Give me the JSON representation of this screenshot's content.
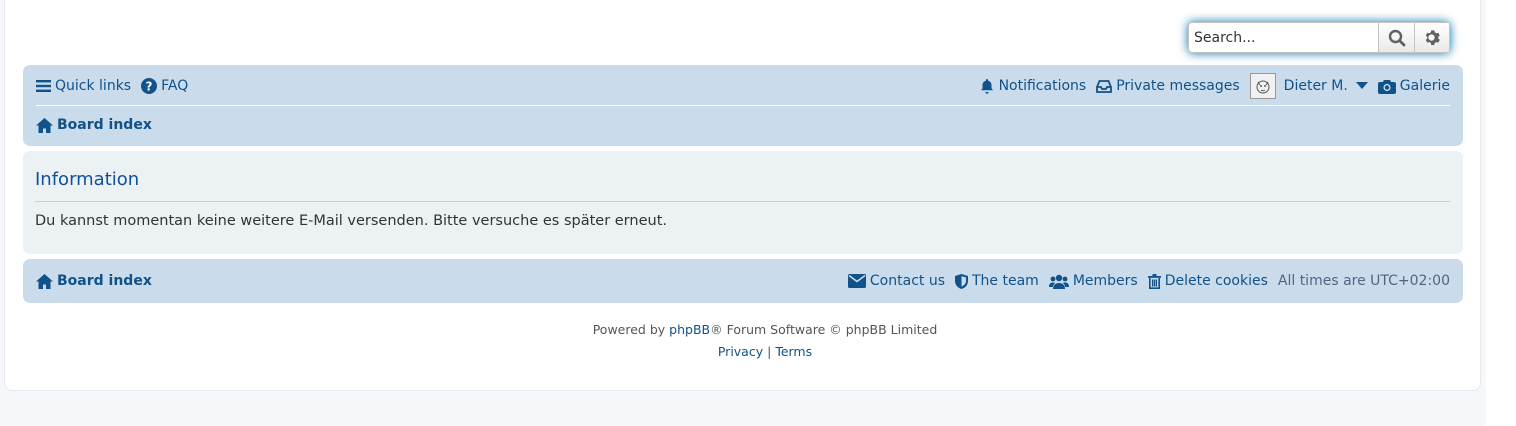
{
  "search": {
    "placeholder": "Search..."
  },
  "top_nav": {
    "quick_links": "Quick links",
    "faq": "FAQ",
    "notifications": "Notifications",
    "private_messages": "Private messages",
    "username": "Dieter M.",
    "galerie": "Galerie",
    "breadcrumb": "Board index"
  },
  "info": {
    "title": "Information",
    "message": "Du kannst momentan keine weitere E-Mail versenden. Bitte versuche es später erneut."
  },
  "bottom_nav": {
    "board_index": "Board index",
    "contact_us": "Contact us",
    "the_team": "The team",
    "members": "Members",
    "delete_cookies": "Delete cookies",
    "timezone": "All times are UTC+02:00"
  },
  "footer": {
    "powered_by": "Powered by",
    "phpbb": "phpBB",
    "forum_software": "® Forum Software © phpBB Limited",
    "privacy": "Privacy",
    "separator": "|",
    "terms": "Terms"
  },
  "colors": {
    "link": "#105289",
    "navbar": "#cadceb",
    "panel": "#ecf1f3",
    "heading": "#115098"
  }
}
